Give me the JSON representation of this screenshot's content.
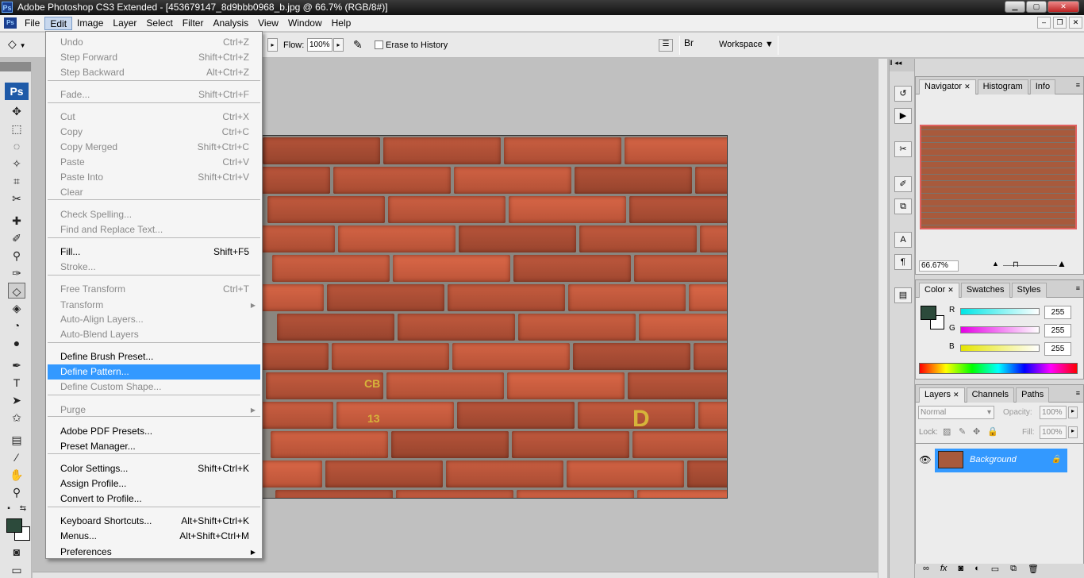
{
  "window": {
    "title": "Adobe Photoshop CS3 Extended - [453679147_8d9bbb0968_b.jpg @ 66.7% (RGB/8#)]",
    "app_icon": "Ps"
  },
  "menubar": {
    "items": [
      "File",
      "Edit",
      "Image",
      "Layer",
      "Select",
      "Filter",
      "Analysis",
      "View",
      "Window",
      "Help"
    ],
    "active": "Edit"
  },
  "options": {
    "flow_label": "Flow:",
    "flow_value": "100%",
    "erase_history_label": "Erase to History",
    "erase_history_checked": false,
    "workspace_label": "Workspace"
  },
  "toolbox": {
    "logo": "Ps",
    "selected_tool": "eraser-tool"
  },
  "edit_menu": {
    "items": [
      {
        "label": "Undo",
        "shortcut": "Ctrl+Z",
        "disabled": true
      },
      {
        "label": "Step Forward",
        "shortcut": "Shift+Ctrl+Z",
        "disabled": true
      },
      {
        "label": "Step Backward",
        "shortcut": "Alt+Ctrl+Z",
        "disabled": true
      },
      {
        "label": "Fade...",
        "shortcut": "Shift+Ctrl+F",
        "disabled": true
      },
      {
        "label": "Cut",
        "shortcut": "Ctrl+X",
        "disabled": true
      },
      {
        "label": "Copy",
        "shortcut": "Ctrl+C",
        "disabled": true
      },
      {
        "label": "Copy Merged",
        "shortcut": "Shift+Ctrl+C",
        "disabled": true
      },
      {
        "label": "Paste",
        "shortcut": "Ctrl+V",
        "disabled": true
      },
      {
        "label": "Paste Into",
        "shortcut": "Shift+Ctrl+V",
        "disabled": true
      },
      {
        "label": "Clear",
        "shortcut": "",
        "disabled": true
      },
      {
        "label": "Check Spelling...",
        "shortcut": "",
        "disabled": true
      },
      {
        "label": "Find and Replace Text...",
        "shortcut": "",
        "disabled": true
      },
      {
        "label": "Fill...",
        "shortcut": "Shift+F5",
        "disabled": false
      },
      {
        "label": "Stroke...",
        "shortcut": "",
        "disabled": true
      },
      {
        "label": "Free Transform",
        "shortcut": "Ctrl+T",
        "disabled": true
      },
      {
        "label": "Transform",
        "shortcut": "",
        "disabled": true,
        "submenu": true
      },
      {
        "label": "Auto-Align Layers...",
        "shortcut": "",
        "disabled": true
      },
      {
        "label": "Auto-Blend Layers",
        "shortcut": "",
        "disabled": true
      },
      {
        "label": "Define Brush Preset...",
        "shortcut": "",
        "disabled": false
      },
      {
        "label": "Define Pattern...",
        "shortcut": "",
        "disabled": false,
        "highlighted": true
      },
      {
        "label": "Define Custom Shape...",
        "shortcut": "",
        "disabled": true
      },
      {
        "label": "Purge",
        "shortcut": "",
        "disabled": true,
        "submenu": true
      },
      {
        "label": "Adobe PDF Presets...",
        "shortcut": "",
        "disabled": false
      },
      {
        "label": "Preset Manager...",
        "shortcut": "",
        "disabled": false
      },
      {
        "label": "Color Settings...",
        "shortcut": "Shift+Ctrl+K",
        "disabled": false
      },
      {
        "label": "Assign Profile...",
        "shortcut": "",
        "disabled": false
      },
      {
        "label": "Convert to Profile...",
        "shortcut": "",
        "disabled": false
      },
      {
        "label": "Keyboard Shortcuts...",
        "shortcut": "Alt+Shift+Ctrl+K",
        "disabled": false
      },
      {
        "label": "Menus...",
        "shortcut": "Alt+Shift+Ctrl+M",
        "disabled": false
      },
      {
        "label": "Preferences",
        "shortcut": "",
        "disabled": false,
        "submenu": true
      }
    ]
  },
  "document": {
    "stamps": [
      "CB",
      "13",
      "D"
    ]
  },
  "navigator_panel": {
    "tabs": [
      "Navigator",
      "Histogram",
      "Info"
    ],
    "zoom": "66.67%"
  },
  "color_panel": {
    "tabs": [
      "Color",
      "Swatches",
      "Styles"
    ],
    "channels": [
      {
        "label": "R",
        "value": "255",
        "color": "#00e5e5"
      },
      {
        "label": "G",
        "value": "255",
        "color": "#e500e5"
      },
      {
        "label": "B",
        "value": "255",
        "color": "#e5e500"
      }
    ],
    "foreground": "#2c4a3b",
    "background": "#ffffff"
  },
  "layers_panel": {
    "tabs": [
      "Layers",
      "Channels",
      "Paths"
    ],
    "blend_mode": "Normal",
    "opacity_label": "Opacity:",
    "opacity_value": "100%",
    "lock_label": "Lock:",
    "fill_label": "Fill:",
    "fill_value": "100%",
    "layers": [
      {
        "name": "Background",
        "locked": true,
        "visible": true
      }
    ]
  },
  "colors": {
    "menu_highlight": "#3399ff",
    "brick": "#a85a3c"
  }
}
